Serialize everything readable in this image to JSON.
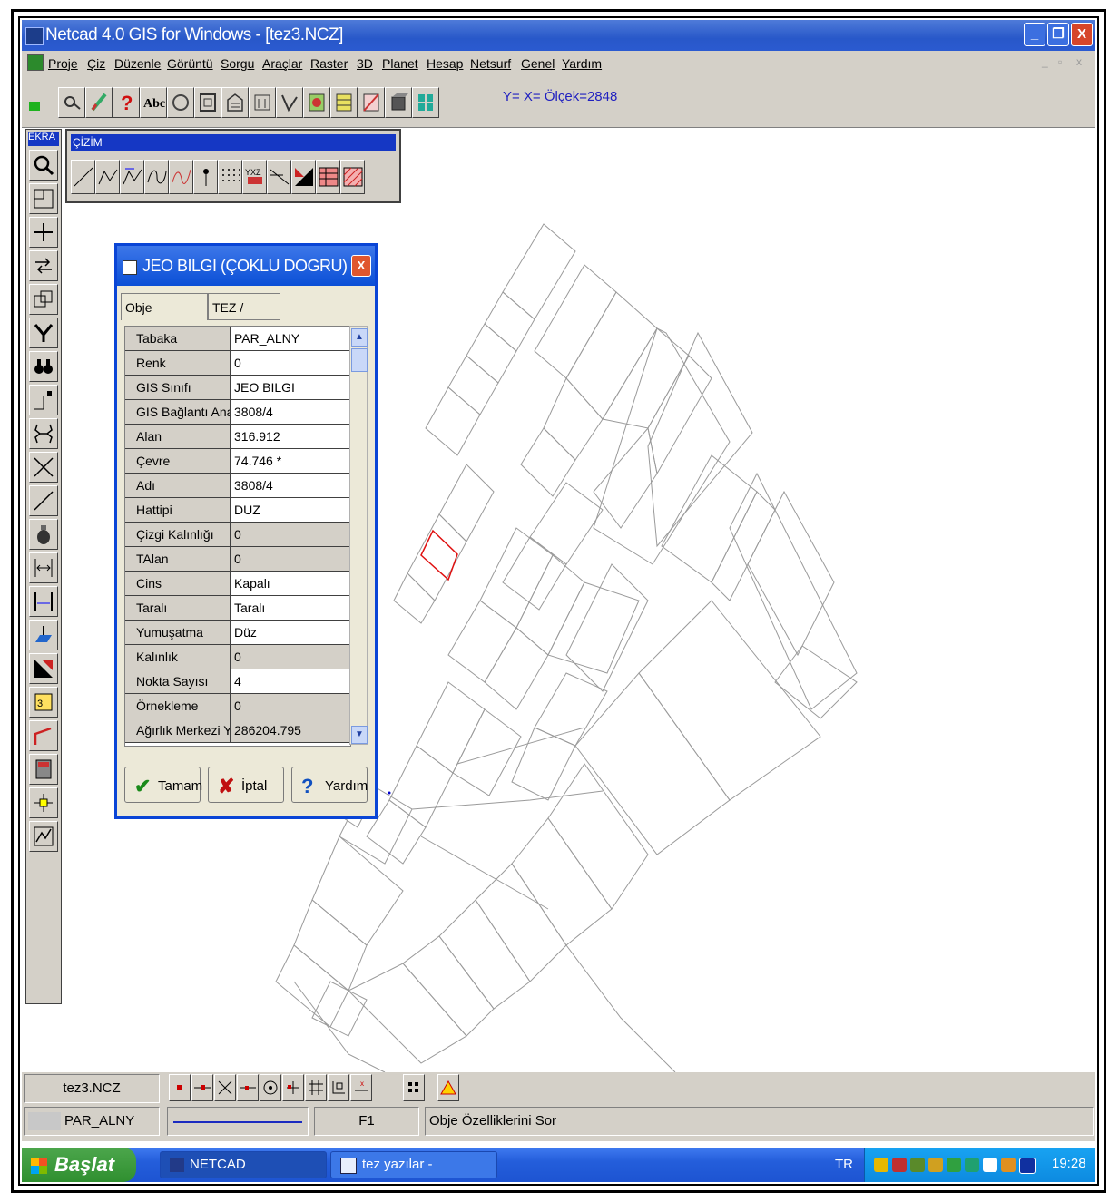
{
  "window": {
    "title": "Netcad 4.0 GIS for Windows - [tez3.NCZ]",
    "min": "_",
    "restore": "❐",
    "close": "X"
  },
  "menu": [
    "Proje",
    "Çiz",
    "Düzenle",
    "Görüntü",
    "Sorgu",
    "Araçlar",
    "Raster",
    "3D",
    "Planet",
    "Hesap",
    "Netsurf",
    "Genel",
    "Yardım"
  ],
  "toolbar": {
    "coords": "Y=   X= Ölçek=2848"
  },
  "left_toolbar": {
    "header": "EKRA"
  },
  "cizim": {
    "header": "ÇİZİM"
  },
  "dialog": {
    "title": "JEO BILGI (ÇOKLU DOGRU)",
    "close": "X",
    "tabs": [
      "Obje Özellikleri",
      "TEZ / jeoloji"
    ],
    "rows": [
      {
        "key": "Tabaka",
        "value": "PAR_ALNY"
      },
      {
        "key": "Renk",
        "value": "0"
      },
      {
        "key": "GIS Sınıfı",
        "value": "JEO BILGI"
      },
      {
        "key": "GIS Bağlantı Ana...",
        "value": "3808/4"
      },
      {
        "key": "Alan",
        "value": "316.912"
      },
      {
        "key": "Çevre",
        "value": "74.746 *"
      },
      {
        "key": "Adı",
        "value": "3808/4"
      },
      {
        "key": "Hattipi",
        "value": "DUZ"
      },
      {
        "key": "Çizgi Kalınlığı",
        "value": "0"
      },
      {
        "key": "TAlan",
        "value": "0"
      },
      {
        "key": "Cins",
        "value": "Kapalı"
      },
      {
        "key": "Taralı",
        "value": "Taralı"
      },
      {
        "key": "Yumuşatma",
        "value": "Düz"
      },
      {
        "key": "Kalınlık",
        "value": "0"
      },
      {
        "key": "Nokta Sayısı",
        "value": "4"
      },
      {
        "key": "Örnekleme",
        "value": "0"
      },
      {
        "key": "Ağırlık Merkezi Y",
        "value": "286204.795"
      }
    ],
    "buttons": {
      "ok": "Tamam",
      "cancel": "İptal",
      "help": "Yardım"
    }
  },
  "statusbar": {
    "file": "tez3.NCZ",
    "layer": "PAR_ALNY",
    "key": "F1",
    "message": "Obje Özelliklerini Sor"
  },
  "taskbar": {
    "start": "Başlat",
    "tasks": [
      "NETCAD",
      "tez yazılar - Microsoft..."
    ],
    "lang": "TR",
    "clock": "19:28"
  }
}
